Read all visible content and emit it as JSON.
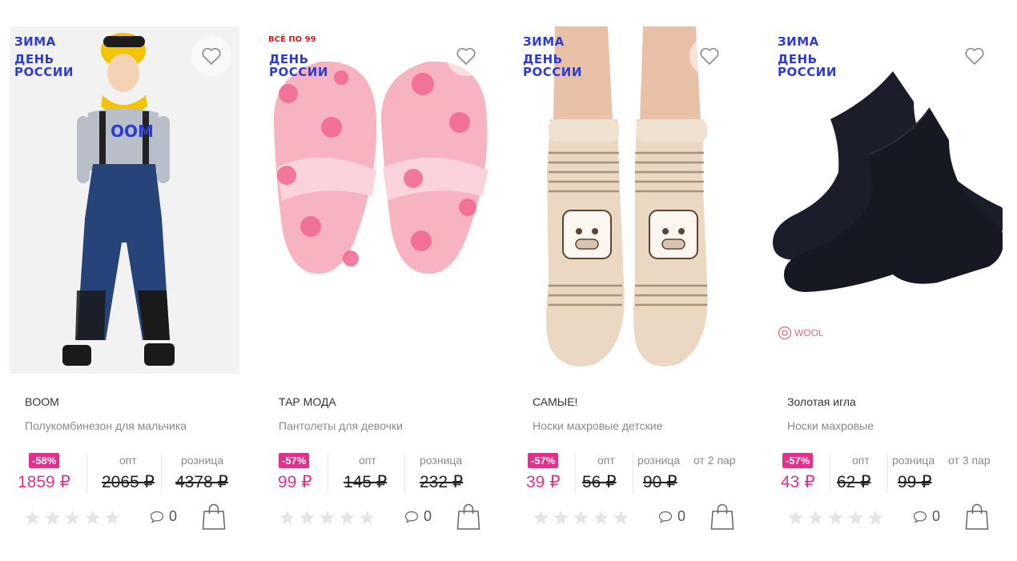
{
  "colors": {
    "accent": "#e5308b",
    "badge_blue": "#2e3bd1",
    "badge_red": "#e3161d"
  },
  "products": [
    {
      "badge_top": "ЗИМА",
      "badge_line1": "ДЕНЬ",
      "badge_line2": "РОССИИ",
      "brand": "BOOM",
      "name": "Полукомбинезон для мальчика",
      "discount": "-58%",
      "price": "1859 ₽",
      "opt_label": "опт",
      "opt_price": "2065 ₽",
      "retail_label": "розница",
      "retail_price": "4378 ₽",
      "extra": "",
      "comments": "0",
      "rating": 0
    },
    {
      "badge_top": "ВСЁ ПО 99",
      "badge_line1": "ДЕНЬ",
      "badge_line2": "РОССИИ",
      "brand": "ТАР МОДА",
      "name": "Пантолеты для девочки",
      "discount": "-57%",
      "price": "99 ₽",
      "opt_label": "опт",
      "opt_price": "145 ₽",
      "retail_label": "розница",
      "retail_price": "232 ₽",
      "extra": "",
      "comments": "0",
      "rating": 0
    },
    {
      "badge_top": "ЗИМА",
      "badge_line1": "ДЕНЬ",
      "badge_line2": "РОССИИ",
      "brand": "САМЫЕ!",
      "name": "Носки махровые детские",
      "discount": "-57%",
      "price": "39 ₽",
      "opt_label": "опт",
      "opt_price": "56 ₽",
      "retail_label": "розница",
      "retail_price": "90 ₽",
      "extra": "от 2 пар",
      "comments": "0",
      "rating": 0
    },
    {
      "badge_top": "ЗИМА",
      "badge_line1": "ДЕНЬ",
      "badge_line2": "РОССИИ",
      "wool_label": "WOOL",
      "brand": "Золотая игла",
      "name": "Носки махровые",
      "discount": "-57%",
      "price": "43 ₽",
      "opt_label": "опт",
      "opt_price": "62 ₽",
      "retail_label": "розница",
      "retail_price": "99 ₽",
      "extra": "от 3 пар",
      "comments": "0",
      "rating": 0
    }
  ],
  "icons": {
    "favorite": "heart-outline-icon",
    "comment": "speech-bubble-icon",
    "cart": "shopping-bag-icon",
    "rating": "star-icon"
  }
}
